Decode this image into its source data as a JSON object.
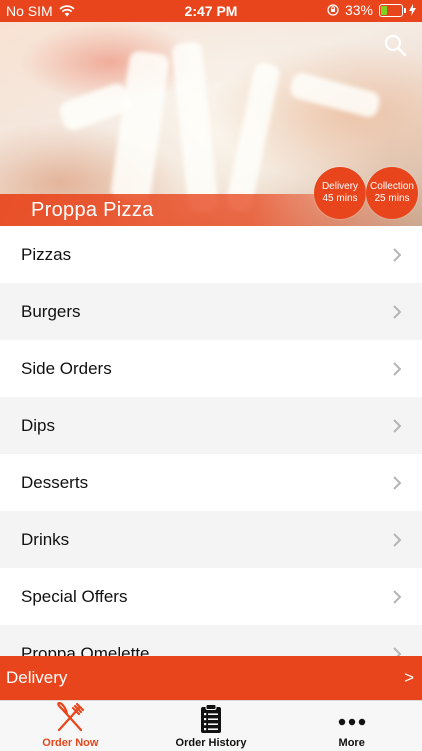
{
  "status_bar": {
    "carrier": "No SIM",
    "time": "2:47 PM",
    "battery_percent": "33%",
    "battery_level": 0.33,
    "battery_color": "#7ed321"
  },
  "hero": {
    "restaurant_name": "Proppa Pizza",
    "search_icon": "search-icon",
    "delivery_badge": {
      "label": "Delivery",
      "value": "45 mins"
    },
    "collection_badge": {
      "label": "Collection",
      "value": "25 mins"
    }
  },
  "menu": {
    "items": [
      {
        "label": "Pizzas"
      },
      {
        "label": "Burgers"
      },
      {
        "label": "Side Orders"
      },
      {
        "label": "Dips"
      },
      {
        "label": "Desserts"
      },
      {
        "label": "Drinks"
      },
      {
        "label": "Special Offers"
      },
      {
        "label": "Proppa Omelette"
      }
    ]
  },
  "delivery_bar": {
    "label": "Delivery",
    "arrow": ">"
  },
  "tabbar": {
    "tabs": [
      {
        "label": "Order Now",
        "icon": "fork-knife-icon",
        "active": true
      },
      {
        "label": "Order History",
        "icon": "clipboard-list-icon",
        "active": false
      },
      {
        "label": "More",
        "icon": "more-dots-icon",
        "active": false
      }
    ]
  },
  "colors": {
    "accent": "#e8451c",
    "tab_active": "#e8451c"
  }
}
